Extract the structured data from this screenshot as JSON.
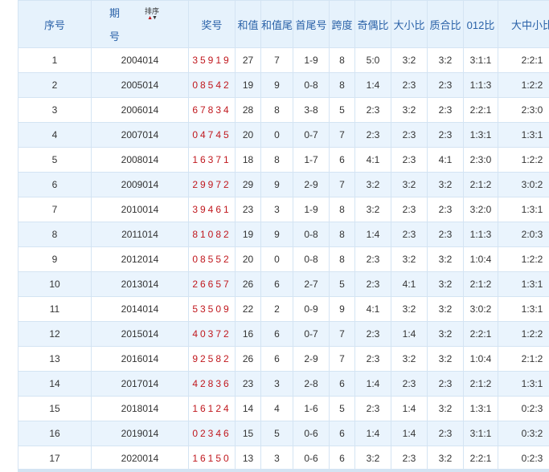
{
  "headers": {
    "index": "序号",
    "period_top": "期",
    "period_bottom": "号",
    "sort_label": "排序",
    "number": "奖号",
    "sum": "和值",
    "sum_tail": "和值尾",
    "head_tail": "首尾号",
    "span": "跨度",
    "odd_even": "奇偶比",
    "big_small": "大小比",
    "prime_composite": "质合比",
    "ratio_012": "012比",
    "big_mid_small": "大中小比"
  },
  "rows": [
    {
      "index": "1",
      "period": "2004014",
      "number": "35919",
      "sum": "27",
      "sum_tail": "7",
      "head_tail": "1-9",
      "span": "8",
      "odd_even": "5:0",
      "big_small": "3:2",
      "prime_composite": "3:2",
      "ratio_012": "3:1:1",
      "big_mid_small": "2:2:1"
    },
    {
      "index": "2",
      "period": "2005014",
      "number": "08542",
      "sum": "19",
      "sum_tail": "9",
      "head_tail": "0-8",
      "span": "8",
      "odd_even": "1:4",
      "big_small": "2:3",
      "prime_composite": "2:3",
      "ratio_012": "1:1:3",
      "big_mid_small": "1:2:2"
    },
    {
      "index": "3",
      "period": "2006014",
      "number": "67834",
      "sum": "28",
      "sum_tail": "8",
      "head_tail": "3-8",
      "span": "5",
      "odd_even": "2:3",
      "big_small": "3:2",
      "prime_composite": "2:3",
      "ratio_012": "2:2:1",
      "big_mid_small": "2:3:0"
    },
    {
      "index": "4",
      "period": "2007014",
      "number": "04745",
      "sum": "20",
      "sum_tail": "0",
      "head_tail": "0-7",
      "span": "7",
      "odd_even": "2:3",
      "big_small": "2:3",
      "prime_composite": "2:3",
      "ratio_012": "1:3:1",
      "big_mid_small": "1:3:1"
    },
    {
      "index": "5",
      "period": "2008014",
      "number": "16371",
      "sum": "18",
      "sum_tail": "8",
      "head_tail": "1-7",
      "span": "6",
      "odd_even": "4:1",
      "big_small": "2:3",
      "prime_composite": "4:1",
      "ratio_012": "2:3:0",
      "big_mid_small": "1:2:2"
    },
    {
      "index": "6",
      "period": "2009014",
      "number": "29972",
      "sum": "29",
      "sum_tail": "9",
      "head_tail": "2-9",
      "span": "7",
      "odd_even": "3:2",
      "big_small": "3:2",
      "prime_composite": "3:2",
      "ratio_012": "2:1:2",
      "big_mid_small": "3:0:2"
    },
    {
      "index": "7",
      "period": "2010014",
      "number": "39461",
      "sum": "23",
      "sum_tail": "3",
      "head_tail": "1-9",
      "span": "8",
      "odd_even": "3:2",
      "big_small": "2:3",
      "prime_composite": "2:3",
      "ratio_012": "3:2:0",
      "big_mid_small": "1:3:1"
    },
    {
      "index": "8",
      "period": "2011014",
      "number": "81082",
      "sum": "19",
      "sum_tail": "9",
      "head_tail": "0-8",
      "span": "8",
      "odd_even": "1:4",
      "big_small": "2:3",
      "prime_composite": "2:3",
      "ratio_012": "1:1:3",
      "big_mid_small": "2:0:3"
    },
    {
      "index": "9",
      "period": "2012014",
      "number": "08552",
      "sum": "20",
      "sum_tail": "0",
      "head_tail": "0-8",
      "span": "8",
      "odd_even": "2:3",
      "big_small": "3:2",
      "prime_composite": "3:2",
      "ratio_012": "1:0:4",
      "big_mid_small": "1:2:2"
    },
    {
      "index": "10",
      "period": "2013014",
      "number": "26657",
      "sum": "26",
      "sum_tail": "6",
      "head_tail": "2-7",
      "span": "5",
      "odd_even": "2:3",
      "big_small": "4:1",
      "prime_composite": "3:2",
      "ratio_012": "2:1:2",
      "big_mid_small": "1:3:1"
    },
    {
      "index": "11",
      "period": "2014014",
      "number": "53509",
      "sum": "22",
      "sum_tail": "2",
      "head_tail": "0-9",
      "span": "9",
      "odd_even": "4:1",
      "big_small": "3:2",
      "prime_composite": "3:2",
      "ratio_012": "3:0:2",
      "big_mid_small": "1:3:1"
    },
    {
      "index": "12",
      "period": "2015014",
      "number": "40372",
      "sum": "16",
      "sum_tail": "6",
      "head_tail": "0-7",
      "span": "7",
      "odd_even": "2:3",
      "big_small": "1:4",
      "prime_composite": "3:2",
      "ratio_012": "2:2:1",
      "big_mid_small": "1:2:2"
    },
    {
      "index": "13",
      "period": "2016014",
      "number": "92582",
      "sum": "26",
      "sum_tail": "6",
      "head_tail": "2-9",
      "span": "7",
      "odd_even": "2:3",
      "big_small": "3:2",
      "prime_composite": "3:2",
      "ratio_012": "1:0:4",
      "big_mid_small": "2:1:2"
    },
    {
      "index": "14",
      "period": "2017014",
      "number": "42836",
      "sum": "23",
      "sum_tail": "3",
      "head_tail": "2-8",
      "span": "6",
      "odd_even": "1:4",
      "big_small": "2:3",
      "prime_composite": "2:3",
      "ratio_012": "2:1:2",
      "big_mid_small": "1:3:1"
    },
    {
      "index": "15",
      "period": "2018014",
      "number": "16124",
      "sum": "14",
      "sum_tail": "4",
      "head_tail": "1-6",
      "span": "5",
      "odd_even": "2:3",
      "big_small": "1:4",
      "prime_composite": "3:2",
      "ratio_012": "1:3:1",
      "big_mid_small": "0:2:3"
    },
    {
      "index": "16",
      "period": "2019014",
      "number": "02346",
      "sum": "15",
      "sum_tail": "5",
      "head_tail": "0-6",
      "span": "6",
      "odd_even": "1:4",
      "big_small": "1:4",
      "prime_composite": "2:3",
      "ratio_012": "3:1:1",
      "big_mid_small": "0:3:2"
    },
    {
      "index": "17",
      "period": "2020014",
      "number": "16150",
      "sum": "13",
      "sum_tail": "3",
      "head_tail": "0-6",
      "span": "6",
      "odd_even": "3:2",
      "big_small": "2:3",
      "prime_composite": "3:2",
      "ratio_012": "2:2:1",
      "big_mid_small": "0:2:3"
    }
  ]
}
